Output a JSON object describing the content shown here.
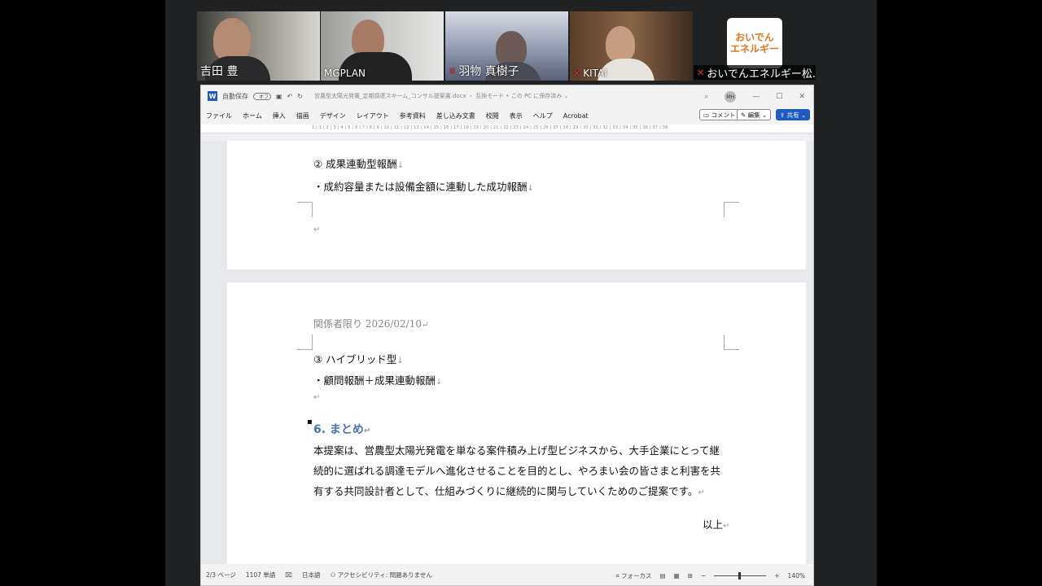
{
  "participants": [
    {
      "name": "吉田 豊",
      "muted": false
    },
    {
      "name": "MGPLAN",
      "muted": false,
      "active": true
    },
    {
      "name": "羽物 真樹子",
      "muted": true
    },
    {
      "name": "KITAI",
      "muted": true
    },
    {
      "name": "おいでんエネルギー松...",
      "muted": true,
      "logo_line1": "おいでん",
      "logo_line2": "エネルギー"
    }
  ],
  "word": {
    "autosave_label": "自動保存",
    "autosave_state": "オフ",
    "doc_title": "営農型太陽光発電_定期調達スキーム_コンサル提案書.docx ・ 互換モード • この PC に保存済み ⌄",
    "avatar_initials": "MH",
    "ribbon_tabs": [
      "ファイル",
      "ホーム",
      "挿入",
      "描画",
      "デザイン",
      "レイアウト",
      "参考資料",
      "差し込み文書",
      "校閲",
      "表示",
      "ヘルプ",
      "Acrobat"
    ],
    "comment_label": "コメント",
    "edit_label": "編集",
    "share_label": "共有",
    "ruler_text": "1 | 1 | 2 | 3 | 4 | 5 | 6 | 7 | 8 | 9 | 10 | 11 | 12 | 13 | 14 | 15 | 16 | 17 | 18 | 19 | 20 | 21 | 22 | 23 | 24 | 25 | 26 | 27 | 28 | 29 | 30 | 31 | 32 | 33 | 34 | 35 | 36 | 37 | 38"
  },
  "doc": {
    "p1_line1": "② 成果連動型報酬",
    "p1_line2": "・成約容量または設備金額に連動した成功報酬",
    "header": "関係者限り 2026/02/10",
    "p2_line1": "③ ハイブリッド型",
    "p2_line2": "・顧問報酬＋成果連動報酬",
    "heading": "6. まとめ",
    "para": "本提案は、営農型太陽光発電を単なる案件積み上げ型ビジネスから、大手企業にとって継続的に選ばれる調達モデルへ進化させることを目的とし、やろまい会の皆さまと利害を共有する共同設計者として、仕組みづくりに継続的に関与していくためのご提案です。",
    "closing": "以上",
    "return_mark": "↵",
    "line_mark": "↓"
  },
  "status": {
    "page": "2/3 ページ",
    "words": "1107 単語",
    "language": "日本語",
    "accessibility": "アクセシビリティ: 問題ありません",
    "focus": "フォーカス",
    "zoom": "140%"
  },
  "colors": {
    "heading": "#4a74b0",
    "active_border": "#3ad28a",
    "share_btn": "#1f5bbf"
  }
}
